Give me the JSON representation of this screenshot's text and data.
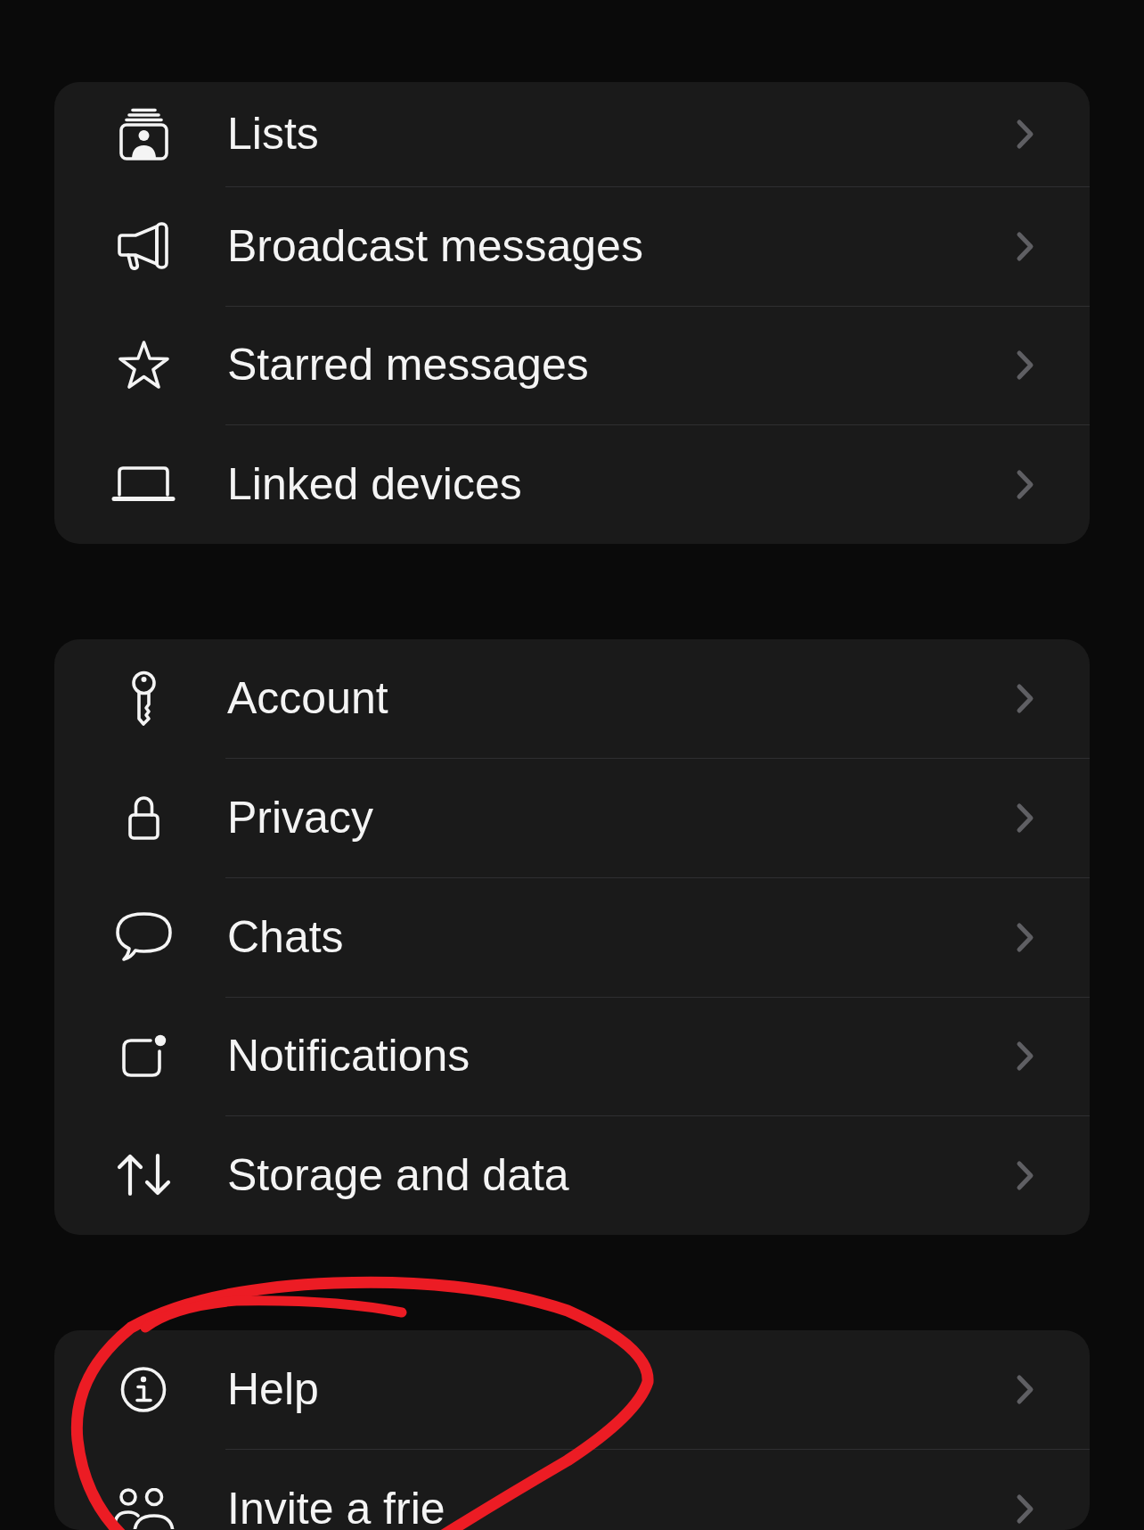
{
  "groups": [
    {
      "items": [
        {
          "label": "Lists"
        },
        {
          "label": "Broadcast messages"
        },
        {
          "label": "Starred messages"
        },
        {
          "label": "Linked devices"
        }
      ]
    },
    {
      "items": [
        {
          "label": "Account"
        },
        {
          "label": "Privacy"
        },
        {
          "label": "Chats"
        },
        {
          "label": "Notifications"
        },
        {
          "label": "Storage and data"
        }
      ]
    },
    {
      "items": [
        {
          "label": "Help"
        },
        {
          "label": "Invite a frie"
        }
      ]
    }
  ]
}
